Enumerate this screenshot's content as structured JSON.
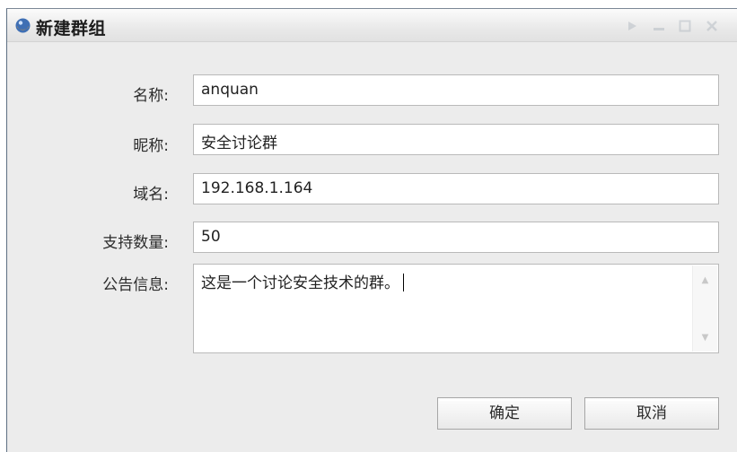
{
  "window": {
    "title": "新建群组",
    "controls": [
      "pin-icon",
      "minimize-icon",
      "maximize-icon",
      "close-icon"
    ]
  },
  "form": {
    "name_label": "名称:",
    "name_value": "anquan",
    "nickname_label": "昵称:",
    "nickname_value": "安全讨论群",
    "domain_label": "域名:",
    "domain_value": "192.168.1.164",
    "capacity_label": "支持数量:",
    "capacity_value": "50",
    "notice_label": "公告信息:",
    "notice_value": "这是一个讨论安全技术的群。"
  },
  "buttons": {
    "confirm": "确定",
    "cancel": "取消"
  }
}
